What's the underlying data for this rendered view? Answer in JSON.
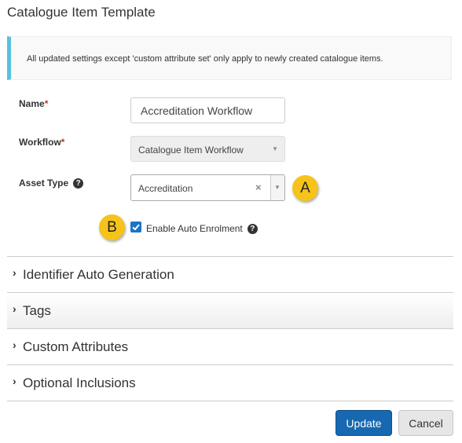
{
  "dialog": {
    "title": "Catalogue Item Template"
  },
  "info": {
    "message": "All updated settings except 'custom attribute set' only apply to newly created catalogue items."
  },
  "form": {
    "name": {
      "label": "Name",
      "required_mark": "*",
      "value": "Accreditation Workflow"
    },
    "workflow": {
      "label": "Workflow",
      "required_mark": "*",
      "value": "Catalogue Item Workflow"
    },
    "asset_type": {
      "label": "Asset Type",
      "value": "Accreditation",
      "clear_icon": "×"
    },
    "auto_enrolment": {
      "label": "Enable Auto Enrolment",
      "checked": true
    }
  },
  "callouts": {
    "a": "A",
    "b": "B"
  },
  "sections": [
    {
      "label": "Identifier Auto Generation"
    },
    {
      "label": "Tags"
    },
    {
      "label": "Custom Attributes"
    },
    {
      "label": "Optional Inclusions"
    }
  ],
  "buttons": {
    "update": "Update",
    "cancel": "Cancel"
  },
  "colors": {
    "accent": "#1768b0",
    "info_border": "#5bc0de",
    "callout": "#f6c31a",
    "required": "#c0392b"
  },
  "icons": {
    "help": "question-circle-icon",
    "chevron": "chevron-right-icon",
    "dropdown": "caret-down-icon"
  }
}
